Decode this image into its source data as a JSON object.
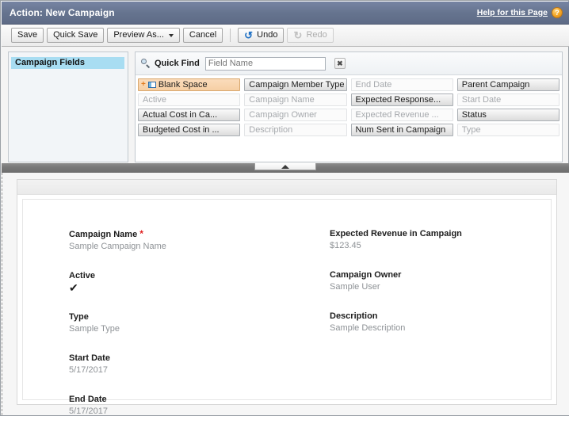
{
  "window": {
    "title": "Action: New Campaign",
    "help_link": "Help for this Page",
    "help_icon": "question-mark-icon",
    "help_glyph": "?"
  },
  "toolbar": {
    "save_label": "Save",
    "quick_save_label": "Quick Save",
    "preview_as_label": "Preview As...",
    "cancel_label": "Cancel",
    "undo_label": "Undo",
    "redo_label": "Redo",
    "undo_glyph": "↺",
    "redo_glyph": "↻",
    "redo_disabled": true
  },
  "palette": {
    "categories": [
      {
        "label": "Campaign Fields",
        "selected": true
      }
    ],
    "quick_find": {
      "label": "Quick Find",
      "icon": "search-icon",
      "placeholder": "Field Name",
      "value": "",
      "clear_glyph": "✖"
    },
    "fields": [
      {
        "label": "Blank Space",
        "state": "blank"
      },
      {
        "label": "Campaign Member Type",
        "state": "enabled"
      },
      {
        "label": "End Date",
        "state": "used"
      },
      {
        "label": "Parent Campaign",
        "state": "enabled"
      },
      {
        "label": "Active",
        "state": "used"
      },
      {
        "label": "Campaign Name",
        "state": "used"
      },
      {
        "label": "Expected Response...",
        "state": "enabled"
      },
      {
        "label": "Start Date",
        "state": "used"
      },
      {
        "label": "Actual Cost in Ca...",
        "state": "enabled"
      },
      {
        "label": "Campaign Owner",
        "state": "used"
      },
      {
        "label": "Expected Revenue ...",
        "state": "used"
      },
      {
        "label": "Status",
        "state": "enabled"
      },
      {
        "label": "Budgeted Cost in ...",
        "state": "enabled"
      },
      {
        "label": "Description",
        "state": "used"
      },
      {
        "label": "Num Sent in Campaign",
        "state": "enabled"
      },
      {
        "label": "Type",
        "state": "used"
      }
    ]
  },
  "splitter": {
    "handle_icon": "collapse-up-arrow-icon"
  },
  "preview": {
    "left_column": [
      {
        "label": "Campaign Name",
        "required": true,
        "value": "Sample Campaign Name",
        "type": "text"
      },
      {
        "label": "Active",
        "required": false,
        "value": "✔",
        "type": "checkbox"
      },
      {
        "label": "Type",
        "required": false,
        "value": "Sample Type",
        "type": "text"
      },
      {
        "label": "Start Date",
        "required": false,
        "value": "5/17/2017",
        "type": "text"
      },
      {
        "label": "End Date",
        "required": false,
        "value": "5/17/2017",
        "type": "text"
      }
    ],
    "right_column": [
      {
        "label": "Expected Revenue in Campaign",
        "required": false,
        "value": "$123.45",
        "type": "text"
      },
      {
        "label": "Campaign Owner",
        "required": false,
        "value": "Sample User",
        "type": "text"
      },
      {
        "label": "Description",
        "required": false,
        "value": "Sample Description",
        "type": "text"
      }
    ]
  },
  "colors": {
    "titlebar": "#66748f",
    "category_highlight": "#a8ddf2",
    "blank_space": "#f6cfa4",
    "required_asterisk": "#e02020",
    "help_icon": "#f5a623",
    "undo_icon": "#1d6fc4"
  }
}
